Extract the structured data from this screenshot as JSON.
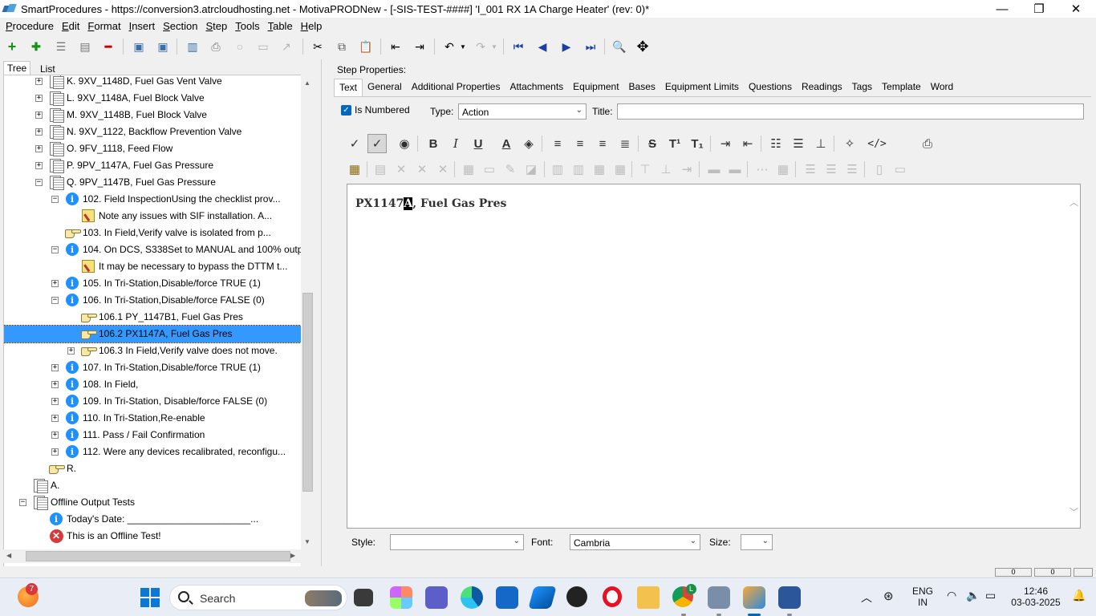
{
  "window": {
    "title": "SmartProcedures - https://conversion3.atrcloudhosting.net - MotivaPRODNew - [-SIS-TEST-####] 'I_001 RX 1A Charge Heater' (rev: 0)*",
    "minimize": "—",
    "maximize": "❐",
    "close": "✕"
  },
  "menu": [
    {
      "u": "P",
      "rest": "rocedure"
    },
    {
      "u": "E",
      "rest": "dit"
    },
    {
      "u": "F",
      "rest": "ormat"
    },
    {
      "u": "I",
      "rest": "nsert"
    },
    {
      "u": "S",
      "rest": "ection"
    },
    {
      "u": "S",
      "rest": "tep"
    },
    {
      "u": "T",
      "rest": "ools"
    },
    {
      "u": "T",
      "rest": "able"
    },
    {
      "u": "H",
      "rest": "elp"
    }
  ],
  "left_tabs": {
    "tree": "Tree",
    "list": "List"
  },
  "tree": [
    {
      "indent": 1,
      "exp": "+",
      "icon": "doc",
      "label": "K. 9XV_1148D, Fuel Gas Vent Valve"
    },
    {
      "indent": 1,
      "exp": "+",
      "icon": "doc",
      "label": "L. 9XV_1148A, Fuel Block Valve"
    },
    {
      "indent": 1,
      "exp": "+",
      "icon": "doc",
      "label": "M. 9XV_1148B, Fuel Block Valve"
    },
    {
      "indent": 1,
      "exp": "+",
      "icon": "doc",
      "label": "N. 9XV_1122, Backflow Prevention Valve"
    },
    {
      "indent": 1,
      "exp": "+",
      "icon": "doc",
      "label": "O. 9FV_1118, Feed Flow"
    },
    {
      "indent": 1,
      "exp": "+",
      "icon": "doc",
      "label": "P. 9PV_1147A, Fuel Gas Pressure"
    },
    {
      "indent": 1,
      "exp": "-",
      "icon": "doc",
      "label": "Q. 9PV_1147B, Fuel Gas Pressure"
    },
    {
      "indent": 2,
      "exp": "-",
      "icon": "info",
      "label": "102. Field InspectionUsing the checklist prov..."
    },
    {
      "indent": 3,
      "exp": "",
      "icon": "note",
      "label": "Note any issues with SIF installation. A..."
    },
    {
      "indent": 2,
      "exp": "",
      "icon": "hand",
      "label": "103. In Field,Verify valve is isolated from p..."
    },
    {
      "indent": 2,
      "exp": "-",
      "icon": "info",
      "label": "104. On DCS, S338Set to MANUAL and 100% outpu..."
    },
    {
      "indent": 3,
      "exp": "",
      "icon": "note",
      "label": "It may be necessary to bypass the DTTM t..."
    },
    {
      "indent": 2,
      "exp": "+",
      "icon": "info",
      "label": "105. In Tri-Station,Disable/force TRUE (1)"
    },
    {
      "indent": 2,
      "exp": "-",
      "icon": "info",
      "label": "106. In Tri-Station,Disable/force FALSE (0)"
    },
    {
      "indent": 3,
      "exp": "",
      "icon": "hand",
      "label": "106.1 PY_1147B1, Fuel Gas Pres"
    },
    {
      "indent": 3,
      "exp": "",
      "icon": "hand",
      "label": "106.2 PX1147A, Fuel Gas Pres",
      "selected": true
    },
    {
      "indent": 3,
      "exp": "+",
      "icon": "hand",
      "label": "106.3 In Field,Verify valve does not move."
    },
    {
      "indent": 2,
      "exp": "+",
      "icon": "info",
      "label": "107. In Tri-Station,Disable/force TRUE (1)"
    },
    {
      "indent": 2,
      "exp": "+",
      "icon": "info",
      "label": "108. In Field,"
    },
    {
      "indent": 2,
      "exp": "+",
      "icon": "info",
      "label": "109. In Tri-Station, Disable/force FALSE (0)"
    },
    {
      "indent": 2,
      "exp": "+",
      "icon": "info",
      "label": "110. In Tri-Station,Re-enable"
    },
    {
      "indent": 2,
      "exp": "+",
      "icon": "info",
      "label": "111. Pass / Fail Confirmation"
    },
    {
      "indent": 2,
      "exp": "+",
      "icon": "info",
      "label": "112. Were any devices recalibrated, reconfigu..."
    },
    {
      "indent": 1,
      "exp": "",
      "icon": "hand",
      "label": "R."
    },
    {
      "indent": 0,
      "exp": "",
      "icon": "doc",
      "label": "A."
    },
    {
      "indent": 0,
      "exp": "-",
      "icon": "doc",
      "label": "Offline Output Tests"
    },
    {
      "indent": 1,
      "exp": "",
      "icon": "info",
      "label": "Today's Date: _______________________..."
    },
    {
      "indent": 1,
      "exp": "",
      "icon": "error",
      "label": "This is an Offline Test!"
    }
  ],
  "step_properties": {
    "heading": "Step Properties:",
    "tabs": [
      "Text",
      "General",
      "Additional Properties",
      "Attachments",
      "Equipment",
      "Bases",
      "Equipment Limits",
      "Questions",
      "Readings",
      "Tags",
      "Template",
      "Word"
    ],
    "is_numbered_label": "Is Numbered",
    "type_label": "Type:",
    "type_value": "Action",
    "title_label": "Title:",
    "title_value": ""
  },
  "editor": {
    "text_before": "PX1147",
    "text_selected": "A",
    "text_after": ", Fuel Gas Pres"
  },
  "bottom": {
    "style_label": "Style:",
    "style_value": "",
    "font_label": "Font:",
    "font_value": "Cambria",
    "size_label": "Size:",
    "size_value": ""
  },
  "statusbar": {
    "box1": "0",
    "box2": "0"
  },
  "taskbar": {
    "badge": "7",
    "search_text": "Search",
    "chrome_badge": "L",
    "lang1": "ENG",
    "lang2": "IN",
    "time": "12:46",
    "date": "03-03-2025"
  },
  "colors": {
    "selection": "#3399ff",
    "accent": "#0067c0"
  }
}
